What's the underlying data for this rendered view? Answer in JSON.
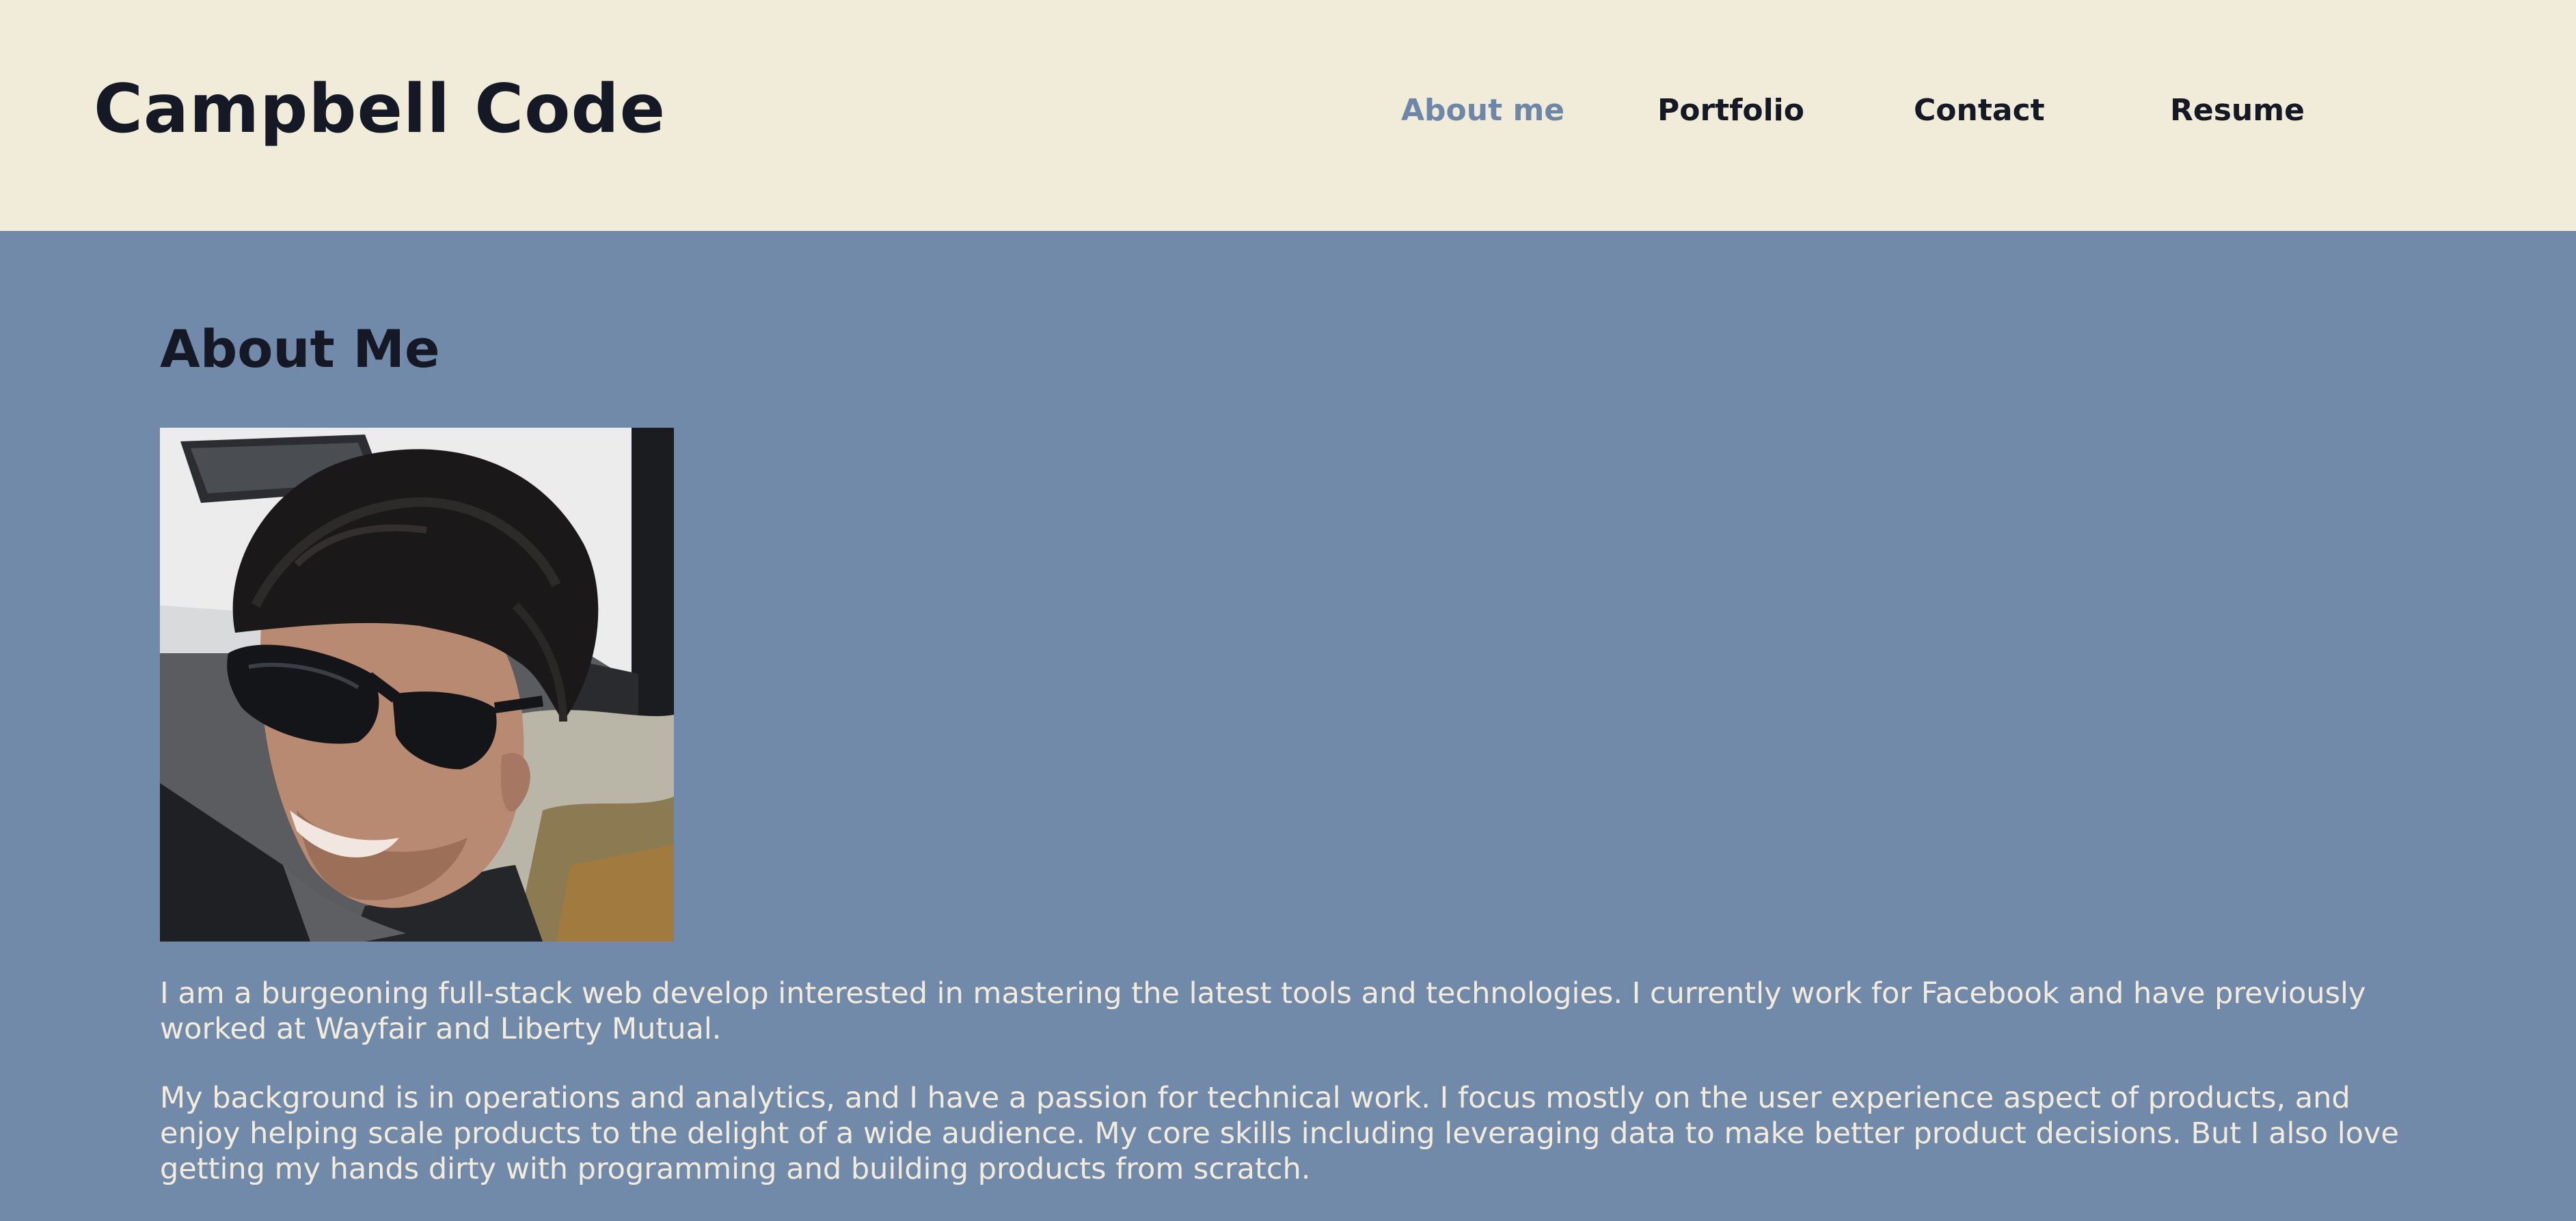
{
  "header": {
    "brand": "Campbell Code",
    "nav": [
      {
        "label": "About me",
        "active": true
      },
      {
        "label": "Portfolio",
        "active": false
      },
      {
        "label": "Contact",
        "active": false
      },
      {
        "label": "Resume",
        "active": false
      }
    ]
  },
  "about": {
    "title": "About Me",
    "photo_icon": "profile-photo",
    "paragraphs": [
      "I am a burgeoning full-stack web develop interested in mastering the latest tools and technologies. I currently work for Facebook and have previously worked at Wayfair and Liberty Mutual.",
      "My background is in operations and analytics, and I have a passion for technical work. I focus mostly on the user experience aspect of products, and enjoy helping scale products to the delight of a wide audience. My core skills including leveraging data to make better product decisions. But I also love getting my hands dirty with programming and building products from scratch."
    ]
  },
  "colors": {
    "header_bg": "#f1ebd9",
    "page_bg": "#728aaa",
    "text_dark": "#141925",
    "nav_active": "#6e87a8",
    "body_text": "#f3ecdc"
  }
}
